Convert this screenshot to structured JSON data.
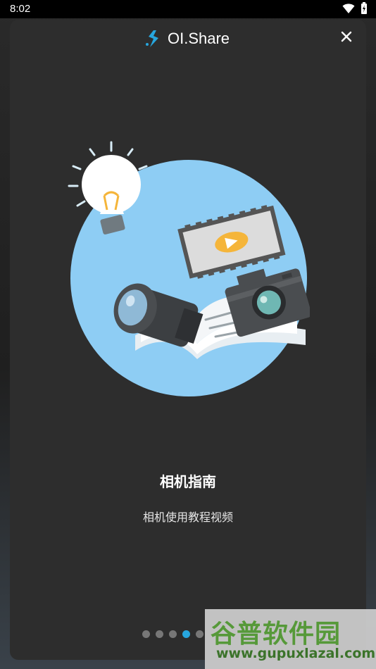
{
  "status_bar": {
    "time": "8:02"
  },
  "header": {
    "app_name": "OI.Share"
  },
  "content": {
    "title": "相机指南",
    "subtitle": "相机使用教程视频"
  },
  "pager": {
    "total": 5,
    "active_index": 3
  },
  "watermark": {
    "main": "谷普软件园",
    "url": "www.gupuxlazal.com"
  },
  "icons": {
    "close": "close-icon",
    "wifi": "wifi-icon",
    "battery": "battery-charging-icon",
    "logo": "oi-share-logo-icon"
  },
  "colors": {
    "accent": "#27a6de",
    "card_bg": "#2d2d2d",
    "circle": "#8ecdf4"
  }
}
